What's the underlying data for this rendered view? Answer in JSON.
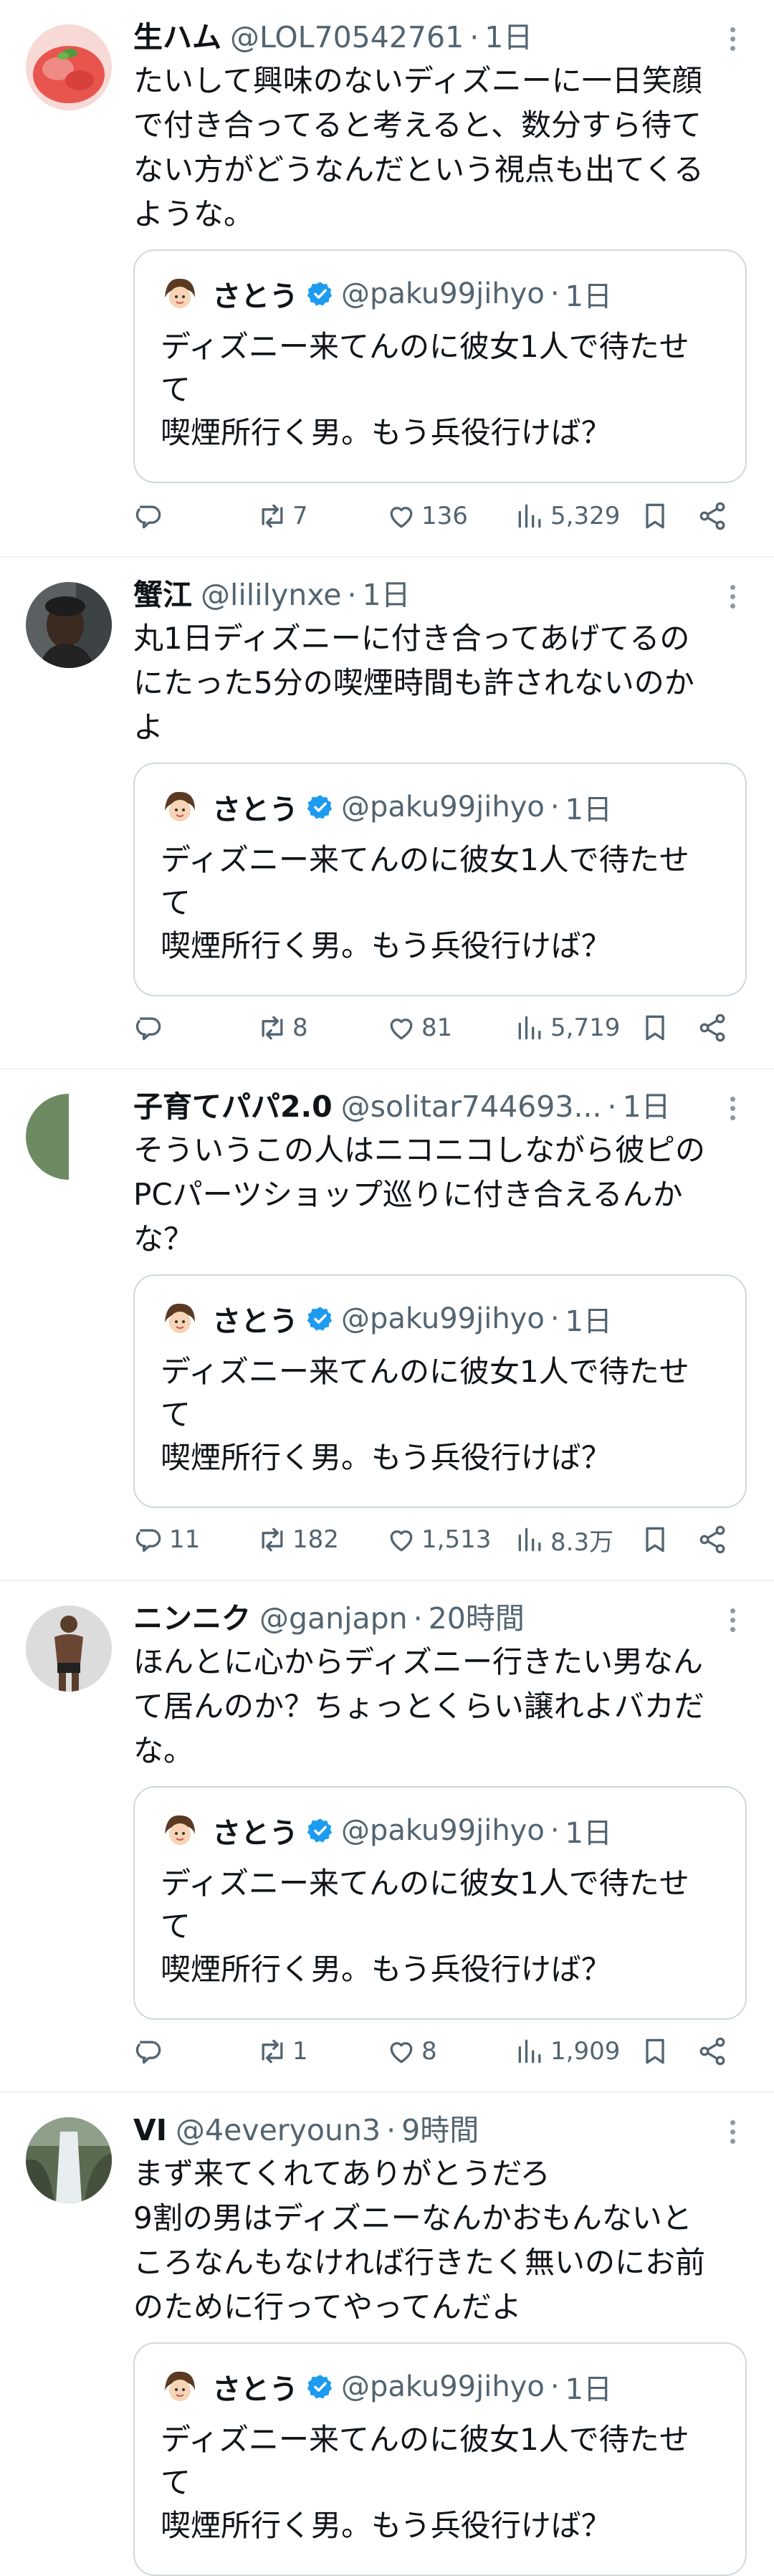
{
  "tweets": [
    {
      "name": "生ハム",
      "handle": "@LOL70542761",
      "dot": "·",
      "time": "1日",
      "text": "たいして興味のないディズニーに一日笑顔\nで付き合ってると考えると、数分すら待て\nない方がどうなんだという視点も出てくる\nような。",
      "quote": {
        "name": "さとう",
        "handle": "@paku99jihyo",
        "dot": "·",
        "time": "1日",
        "text": "ディズニー来てんのに彼女1人で待たせ\nて\n喫煙所行く男。もう兵役行けば？"
      },
      "reply_count": "",
      "retweet_count": "7",
      "like_count": "136",
      "view_count": "5,329"
    },
    {
      "name": "蟹江",
      "handle": "@lililynxe",
      "dot": "·",
      "time": "1日",
      "text": "丸1日ディズニーに付き合ってあげてるの\nにたった5分の喫煙時間も許されないのか\nよ",
      "quote": {
        "name": "さとう",
        "handle": "@paku99jihyo",
        "dot": "·",
        "time": "1日",
        "text": "ディズニー来てんのに彼女1人で待たせ\nて\n喫煙所行く男。もう兵役行けば？"
      },
      "reply_count": "",
      "retweet_count": "8",
      "like_count": "81",
      "view_count": "5,719"
    },
    {
      "name": "子育てパパ2.0",
      "handle": "@solitar744693...",
      "dot": "·",
      "time": "1日",
      "text": "そういうこの人はニコニコしながら彼ピの\nPCパーツショップ巡りに付き合えるんか\nな？",
      "quote": {
        "name": "さとう",
        "handle": "@paku99jihyo",
        "dot": "·",
        "time": "1日",
        "text": "ディズニー来てんのに彼女1人で待たせ\nて\n喫煙所行く男。もう兵役行けば？"
      },
      "reply_count": "11",
      "retweet_count": "182",
      "like_count": "1,513",
      "view_count": "8.3万"
    },
    {
      "name": "ニンニク",
      "handle": "@ganjapn",
      "dot": "·",
      "time": "20時間",
      "text": "ほんとに心からディズニー行きたい男なん\nて居んのか？ちょっとくらい譲れよバカだ\nな。",
      "quote": {
        "name": "さとう",
        "handle": "@paku99jihyo",
        "dot": "·",
        "time": "1日",
        "text": "ディズニー来てんのに彼女1人で待たせ\nて\n喫煙所行く男。もう兵役行けば？"
      },
      "reply_count": "",
      "retweet_count": "1",
      "like_count": "8",
      "view_count": "1,909"
    },
    {
      "name": "VI",
      "handle": "@4everyoun3",
      "dot": "·",
      "time": "9時間",
      "text": "まず来てくれてありがとうだろ\n9割の男はディズニーなんかおもんないと\nころなんもなければ行きたく無いのにお前\nのために行ってやってんだよ",
      "quote": {
        "name": "さとう",
        "handle": "@paku99jihyo",
        "dot": "·",
        "time": "1日",
        "text": "ディズニー来てんのに彼女1人で待たせ\nて\n喫煙所行く男。もう兵役行けば？"
      },
      "reply_count": "",
      "retweet_count": "",
      "like_count": "",
      "view_count": ""
    }
  ],
  "icons": {
    "reply": "reply-icon",
    "retweet": "retweet-icon",
    "like": "heart-icon",
    "views": "views-icon",
    "bookmark": "bookmark-icon",
    "share": "share-icon",
    "verified": "verified-badge-icon",
    "more": "more-options-icon"
  },
  "colors": {
    "text": "#0f1419",
    "secondary": "#536471",
    "border": "#cfd9de",
    "divider": "#eff3f4",
    "verified": "#1d9bf0"
  }
}
